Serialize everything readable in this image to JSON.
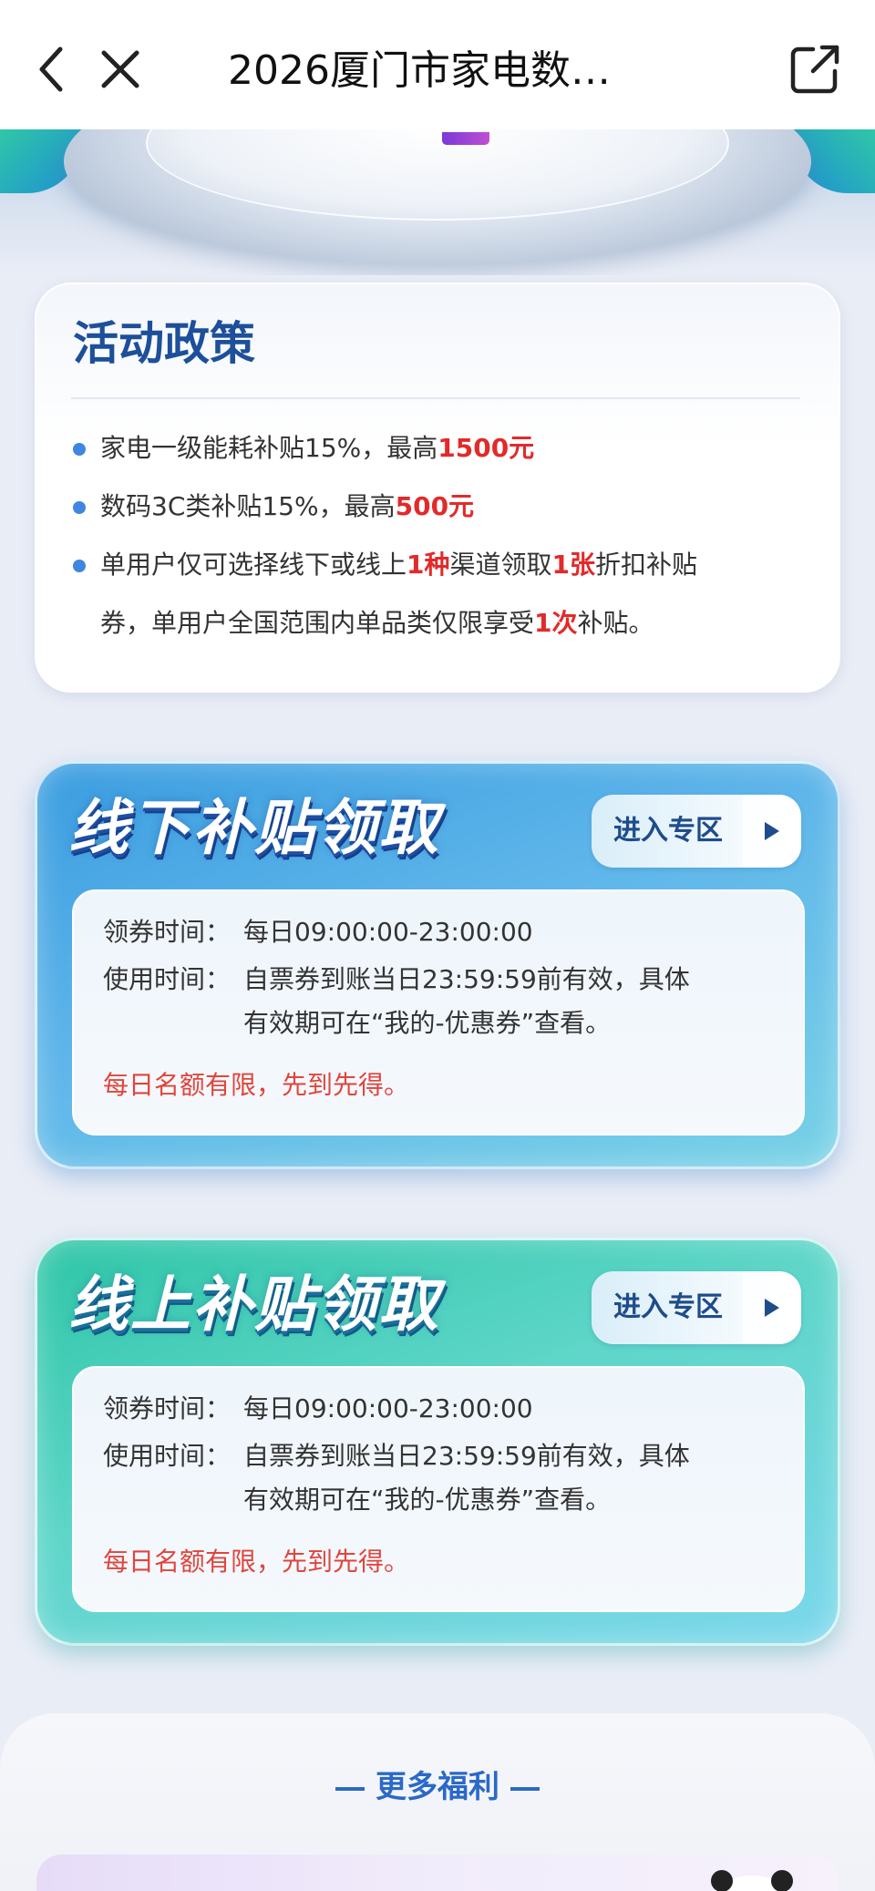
{
  "nav": {
    "title": "2026厦门市家电数…"
  },
  "policy": {
    "title": "活动政策",
    "items": [
      {
        "pre": "家电一级能耗补贴15%，最高",
        "hl": "1500元",
        "post": ""
      },
      {
        "pre": "数码3C类补贴15%，最高",
        "hl": "500元",
        "post": ""
      },
      {
        "line1_pre": "单用户仅可选择线下或线上",
        "line1_hl1": "1种",
        "line1_mid": "渠道领取",
        "line1_hl2": "1张",
        "line1_post": "折扣补贴",
        "line2_pre": "券，单用户全国范围内单品类仅限享受",
        "line2_hl": "1次",
        "line2_post": "补贴。"
      }
    ]
  },
  "offline": {
    "heading": "线下补贴领取",
    "button": "进入专区",
    "claim_label": "领券时间：",
    "claim_value": "每日09:00:00-23:00:00",
    "use_label": "使用时间：",
    "use_value_line1": "自票券到账当日23:59:59前有效，具体",
    "use_value_line2": "有效期可在“我的-优惠券”查看。",
    "notice": "每日名额有限，先到先得。"
  },
  "online": {
    "heading": "线上补贴领取",
    "button": "进入专区",
    "claim_label": "领券时间：",
    "claim_value": "每日09:00:00-23:00:00",
    "use_label": "使用时间：",
    "use_value_line1": "自票券到账当日23:59:59前有效，具体",
    "use_value_line2": "有效期可在“我的-优惠券”查看。",
    "notice": "每日名额有限，先到先得。"
  },
  "more": {
    "title": "更多福利"
  },
  "icons": {
    "back": "chevron-left-icon",
    "close": "close-icon",
    "share": "share-icon"
  },
  "colors": {
    "accent_blue": "#1d4f9a",
    "highlight_red": "#e22a2a",
    "notice_red": "#e0453d",
    "offline_card": "#3b9de0",
    "online_card": "#2fc6a8"
  }
}
